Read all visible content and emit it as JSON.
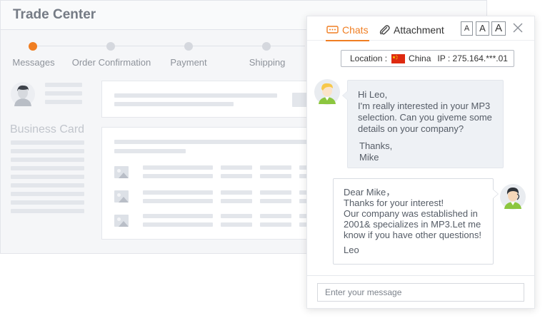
{
  "trade_center": {
    "title": "Trade Center",
    "steps": [
      {
        "label": "Messages",
        "active": true
      },
      {
        "label": "Order Confirmation",
        "active": false
      },
      {
        "label": "Payment",
        "active": false
      },
      {
        "label": "Shipping",
        "active": false
      }
    ],
    "business_card_label": "Business Card"
  },
  "chat": {
    "tabs": {
      "chats": "Chats",
      "attachment": "Attachment"
    },
    "font_sizes": [
      "A",
      "A",
      "A"
    ],
    "location": {
      "label": "Location :",
      "country": "China",
      "ip": "IP : 275.164.***.01"
    },
    "messages": {
      "incoming": {
        "lines": [
          "Hi Leo,",
          "I'm really interested in your MP3",
          "selection. Can you giveme some",
          "details on your company?"
        ],
        "signoff": [
          "Thanks,",
          "Mike"
        ]
      },
      "outgoing": {
        "lines": [
          "Dear Mike，",
          "Thanks for your interest!",
          "Our company was established in",
          "2001& specializes in MP3.Let me",
          "know if you have other questions!"
        ],
        "signoff": "Leo"
      }
    },
    "input_placeholder": "Enter your message"
  },
  "colors": {
    "accent": "#f07e22",
    "bubble_in": "#eef1f5"
  },
  "icons": [
    "chat-bubble-icon",
    "paperclip-icon",
    "close-icon",
    "china-flag-icon",
    "image-placeholder-icon",
    "avatar-icon"
  ]
}
